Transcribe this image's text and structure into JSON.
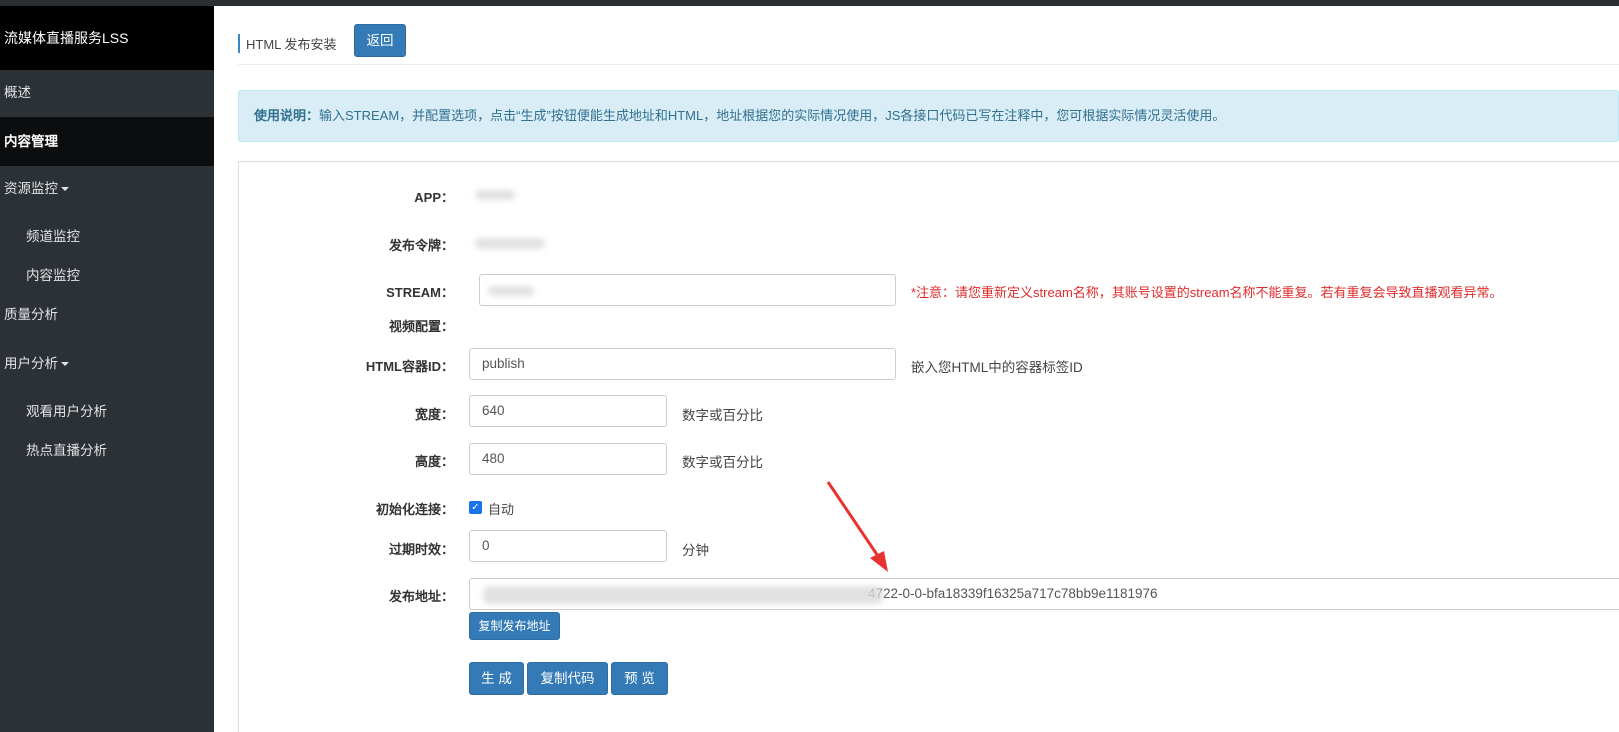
{
  "app_title": "流媒体直播服务LSS",
  "sidebar": {
    "items": [
      {
        "label": "概述"
      },
      {
        "label": "内容管理"
      },
      {
        "label": "资源监控"
      },
      {
        "label": "频道监控"
      },
      {
        "label": "内容监控"
      },
      {
        "label": "质量分析"
      },
      {
        "label": "用户分析"
      },
      {
        "label": "观看用户分析"
      },
      {
        "label": "热点直播分析"
      }
    ]
  },
  "header": {
    "title": "HTML 发布安装",
    "back_label": "返回"
  },
  "info": {
    "title": "使用说明：",
    "text": "输入STREAM，并配置选项，点击“生成”按钮便能生成地址和HTML，地址根据您的实际情况使用，JS各接口代码已写在注释中，您可根据实际情况灵活使用。"
  },
  "form": {
    "app_label": "APP：",
    "token_label": "发布令牌：",
    "stream_label": "STREAM：",
    "stream_warning": "*注意：请您重新定义stream名称，其账号设置的stream名称不能重复。若有重复会导致直播观看异常。",
    "video_config_label": "视频配置：",
    "container_label": "HTML容器ID：",
    "container_value": "publish",
    "container_hint": "嵌入您HTML中的容器标签ID",
    "width_label": "宽度：",
    "width_value": "640",
    "width_hint": "数字或百分比",
    "height_label": "高度：",
    "height_value": "480",
    "height_hint": "数字或百分比",
    "init_label": "初始化连接：",
    "init_checked": true,
    "init_option": "自动",
    "expire_label": "过期时效：",
    "expire_value": "0",
    "expire_hint": "分钟",
    "publish_label": "发布地址：",
    "publish_value_visible": "4722-0-0-bfa18339f16325a717c78bb9e1181976",
    "copy_address_label": "复制发布地址"
  },
  "actions": {
    "generate_label": "生 成",
    "copy_code_label": "复制代码",
    "preview_label": "预 览"
  },
  "colors": {
    "primary": "#337ab7",
    "warning": "#e02b2b",
    "annotation_arrow": "#e8322f"
  }
}
